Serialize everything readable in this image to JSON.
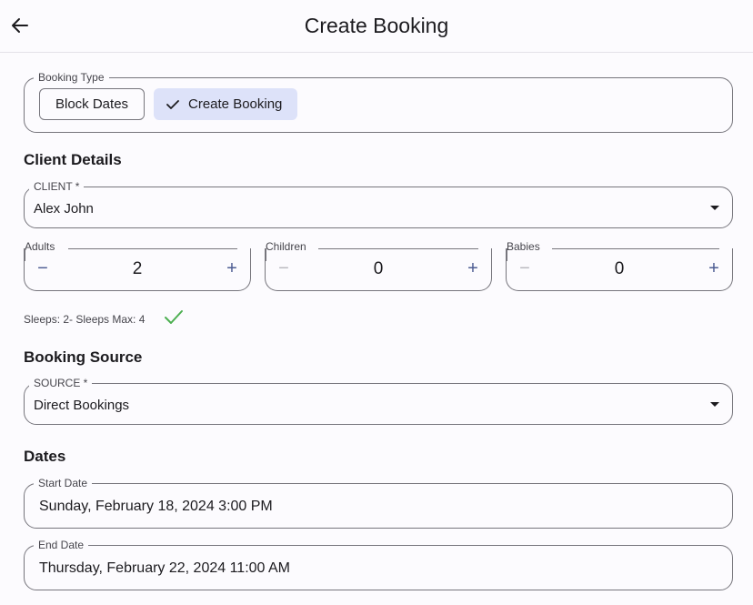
{
  "appbar": {
    "title": "Create Booking"
  },
  "booking_type": {
    "legend": "Booking Type",
    "options": [
      {
        "label": "Block Dates",
        "selected": false
      },
      {
        "label": "Create Booking",
        "selected": true
      }
    ]
  },
  "client_details": {
    "title": "Client Details",
    "client_legend": "CLIENT *",
    "client_value": "Alex John"
  },
  "guests": {
    "adults": {
      "label": "Adults",
      "value": "2",
      "minus": "−",
      "plus": "+"
    },
    "children": {
      "label": "Children",
      "value": "0",
      "minus": "−",
      "plus": "+"
    },
    "babies": {
      "label": "Babies",
      "value": "0",
      "minus": "−",
      "plus": "+"
    },
    "sleeps_text": "Sleeps: 2- Sleeps Max: 4"
  },
  "booking_source": {
    "title": "Booking Source",
    "source_legend": "SOURCE *",
    "source_value": "Direct Bookings"
  },
  "dates": {
    "title": "Dates",
    "start_legend": "Start Date",
    "start_value": "Sunday, February 18, 2024 3:00 PM",
    "end_legend": "End Date",
    "end_value": "Thursday, February 22, 2024 11:00 AM"
  },
  "colors": {
    "accent": "#4c5c92",
    "selected_chip": "#dde2f9",
    "success": "#4caf50",
    "outline": "#76757c",
    "disabled": "#b8b7bd"
  }
}
